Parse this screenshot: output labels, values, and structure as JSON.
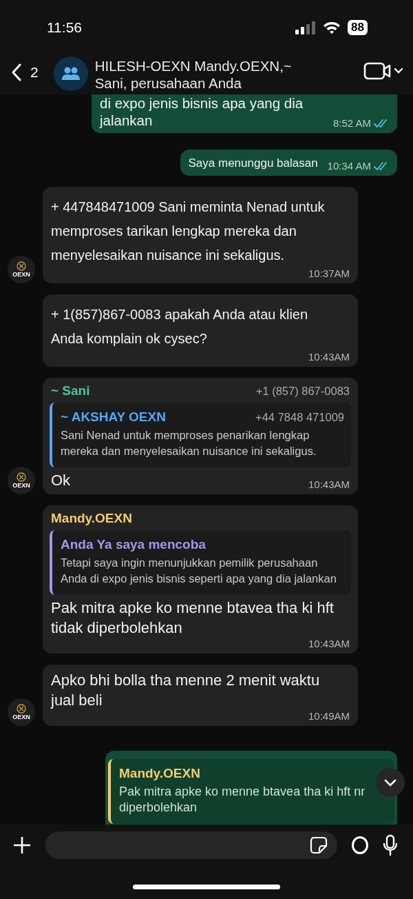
{
  "status_bar": {
    "time": "11:56",
    "battery": "88"
  },
  "header": {
    "back_count": "2",
    "title": "HILESH-OEXN Mandy.OEXN,~ Sani, perusahaan Anda"
  },
  "messages": [
    {
      "kind": "outgoing",
      "text": "di expo jenis bisnis apa yang dia jalankan",
      "time": "8:52 AM",
      "read": true,
      "cut_top": true
    },
    {
      "kind": "outgoing",
      "text": "Saya menunggu balasan",
      "time": "10:34 AM",
      "read": true
    },
    {
      "kind": "incoming",
      "text": "+ 447848471009 Sani meminta Nenad untuk memproses tarikan lengkap mereka dan menyelesaikan nuisance ini sekaligus.",
      "time": "10:37AM",
      "avatar": "OEXN",
      "spacious": true
    },
    {
      "kind": "incoming",
      "text": "+ 1(857)867-0083 apakah Anda atau klien Anda komplain ok cysec?",
      "time": "10:43AM",
      "spacious": true
    },
    {
      "kind": "incoming",
      "sender": "~ Sani",
      "color": "#4fc3a1",
      "phone": "+1 (857) 867-0083",
      "quote": {
        "author": "~ AKSHAY OEXN",
        "color": "#53a6f5",
        "phone": "+44 7848 471009",
        "text": "Sani Nenad untuk memproses penarikan lengkap mereka dan menyelesaikan nuisance ini sekaligus."
      },
      "text": "Ok",
      "time": "10:43AM",
      "avatar": "OEXN"
    },
    {
      "kind": "incoming",
      "sender": "Mandy.OEXN",
      "color": "#f5cc6e",
      "quote": {
        "author": "Anda Ya saya mencoba",
        "color": "#a796e8",
        "text": "Tetapi saya ingin menunjukkan pemilik perusahaan Anda di expo jenis bisnis seperti apa yang dia jalankan"
      },
      "text": "Pak mitra apke ko menne btavea tha ki hft tidak diperbolehkan",
      "time": "10:43AM"
    },
    {
      "kind": "incoming",
      "text": "Apko bhi bolla tha menne 2 menit waktu jual beli",
      "time": "10:49AM",
      "avatar": "OEXN"
    },
    {
      "kind": "outgoing",
      "quote": {
        "author": "Mandy.OEXN",
        "color": "#f5cc6e",
        "text": "Pak mitra apke ko menne btavea tha ki hft nr diperbolehkan"
      },
      "cut_bottom": true
    }
  ]
}
